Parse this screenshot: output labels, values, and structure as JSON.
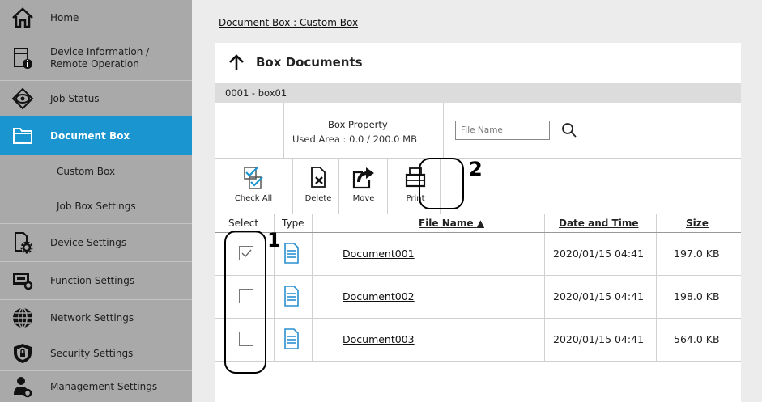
{
  "sidebar": {
    "items": [
      {
        "label": "Home",
        "icon": "home-icon"
      },
      {
        "label": "Device Information /\nRemote Operation",
        "icon": "device-info-icon"
      },
      {
        "label": "Job Status",
        "icon": "eye-icon"
      },
      {
        "label": "Document Box",
        "icon": "folder-icon",
        "active": true
      },
      {
        "label": "Custom Box",
        "sub": true
      },
      {
        "label": "Job Box Settings",
        "sub": true
      },
      {
        "label": "Device Settings",
        "icon": "device-settings-icon"
      },
      {
        "label": "Function Settings",
        "icon": "function-settings-icon"
      },
      {
        "label": "Network Settings",
        "icon": "globe-icon"
      },
      {
        "label": "Security Settings",
        "icon": "shield-icon"
      },
      {
        "label": "Management Settings",
        "icon": "user-gear-icon"
      }
    ]
  },
  "breadcrumb": "Document Box : Custom Box",
  "panel_title": "Box Documents",
  "box_name": "0001 - box01",
  "box_property": {
    "link": "Box Property",
    "used": "Used Area : 0.0 / 200.0 MB"
  },
  "search": {
    "placeholder": "File Name"
  },
  "toolbar": {
    "check_all": "Check All",
    "delete": "Delete",
    "move": "Move",
    "print": "Print"
  },
  "table": {
    "columns": {
      "select": "Select",
      "type": "Type",
      "file_name": "File Name",
      "date": "Date and Time",
      "size": "Size"
    },
    "rows": [
      {
        "name": "Document001",
        "date": "2020/01/15 04:41",
        "size": "197.0 KB",
        "checked": true
      },
      {
        "name": "Document002",
        "date": "2020/01/15 04:41",
        "size": "198.0 KB",
        "checked": false
      },
      {
        "name": "Document003",
        "date": "2020/01/15 04:41",
        "size": "564.0 KB",
        "checked": false
      }
    ]
  },
  "callouts": {
    "one": "1",
    "two": "2"
  },
  "colors": {
    "accent": "#1a95cf",
    "sidebar": "#a9a9a9",
    "file_icon": "#2a8fd0"
  }
}
